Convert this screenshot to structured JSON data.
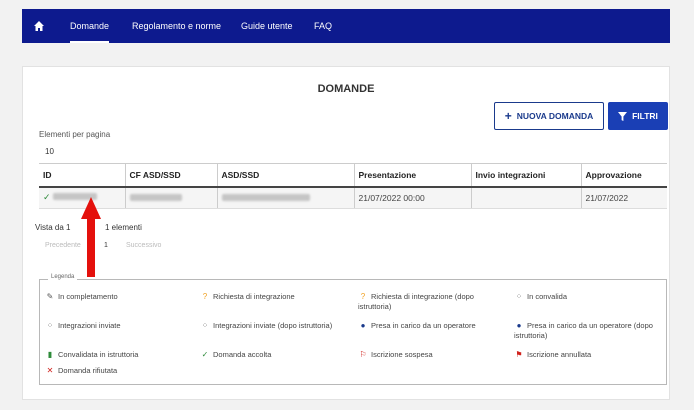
{
  "nav": {
    "home_icon": "home-icon",
    "items": [
      "Domande",
      "Regolamento e norme",
      "Guide utente",
      "FAQ"
    ]
  },
  "page": {
    "title": "DOMANDE",
    "new_button": "NUOVA DOMANDA",
    "filter_button": "FILTRI"
  },
  "pagination": {
    "per_page_label": "Elementi per pagina",
    "per_page_value": "10",
    "summary_left": "Vista da 1",
    "summary_right": "1 elementi",
    "prev": "Precedente",
    "current": "1",
    "next": "Successivo"
  },
  "table": {
    "headers": [
      "ID",
      "CF ASD/SSD",
      "ASD/SSD",
      "Presentazione",
      "Invio integrazioni",
      "Approvazione"
    ],
    "row": {
      "presentazione": "21/07/2022 00:00",
      "approvazione": "21/07/2022"
    }
  },
  "legend": {
    "title": "Legenda",
    "items": [
      "In completamento",
      "Richiesta di integrazione",
      "Richiesta di integrazione (dopo istruttoria)",
      "In convalida",
      "Integrazioni inviate",
      "Integrazioni inviate (dopo istruttoria)",
      "Presa in carico da un operatore",
      "Presa in carico da un operatore (dopo istruttoria)",
      "Convalidata in istruttoria",
      "Domanda accolta",
      "Iscrizione sospesa",
      "Iscrizione annullata",
      "Domanda rifiutata"
    ]
  },
  "colors": {
    "navbar": "#0d1a8e",
    "primary": "#1a3fb5",
    "accepted": "#2e8b3a",
    "warning": "#f0a020",
    "danger": "#d0211c"
  }
}
